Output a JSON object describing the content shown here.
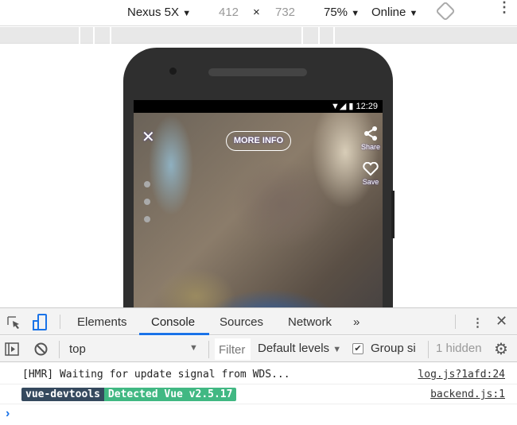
{
  "toolbar": {
    "device": "Nexus 5X",
    "width": "412",
    "x": "×",
    "height": "732",
    "zoom": "75%",
    "throttle": "Online",
    "dropdown": "▼"
  },
  "phone": {
    "status_time": "12:29",
    "status_icons": "▼◢ ▮",
    "close": "✕",
    "more_info": "MORE INFO",
    "share": "Share",
    "save": "Save"
  },
  "devtools": {
    "tabs": [
      "Elements",
      "Console",
      "Sources",
      "Network"
    ],
    "more_tabs": "»",
    "active_tab": "Console",
    "context": "top",
    "filter_placeholder": "Filter",
    "levels": "Default levels",
    "group_similar": "Group si",
    "group_checked": true,
    "hidden": "1 hidden",
    "messages": [
      {
        "text": "[HMR] Waiting for update signal from WDS...",
        "source": "log.js?1afd:24"
      },
      {
        "badge1": "vue-devtools",
        "badge2": "Detected Vue v2.5.17",
        "source": "backend.js:1"
      }
    ],
    "prompt": "›"
  },
  "colors": {
    "accent": "#1a73e8",
    "badge_dark": "#35495e",
    "badge_green": "#41b883"
  }
}
